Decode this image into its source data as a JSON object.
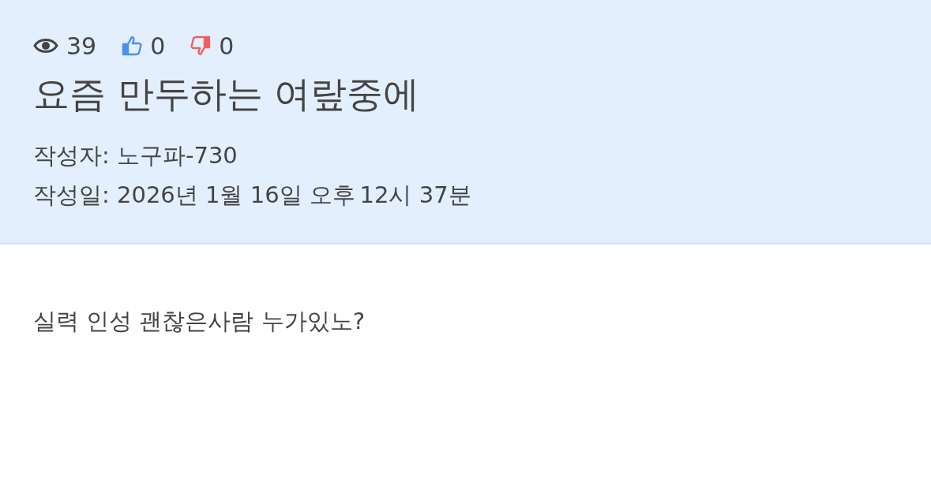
{
  "stats": {
    "views": "39",
    "likes": "0",
    "dislikes": "0"
  },
  "title": "요즘 만두하는 여랖중에",
  "author": {
    "label": "작성자:",
    "value": "노구파-730"
  },
  "date": {
    "label": "작성일:",
    "value": "2026년 1월 16일 오후 12시 37분"
  },
  "body": "실력 인성 괜찮은사람 누가있노?"
}
